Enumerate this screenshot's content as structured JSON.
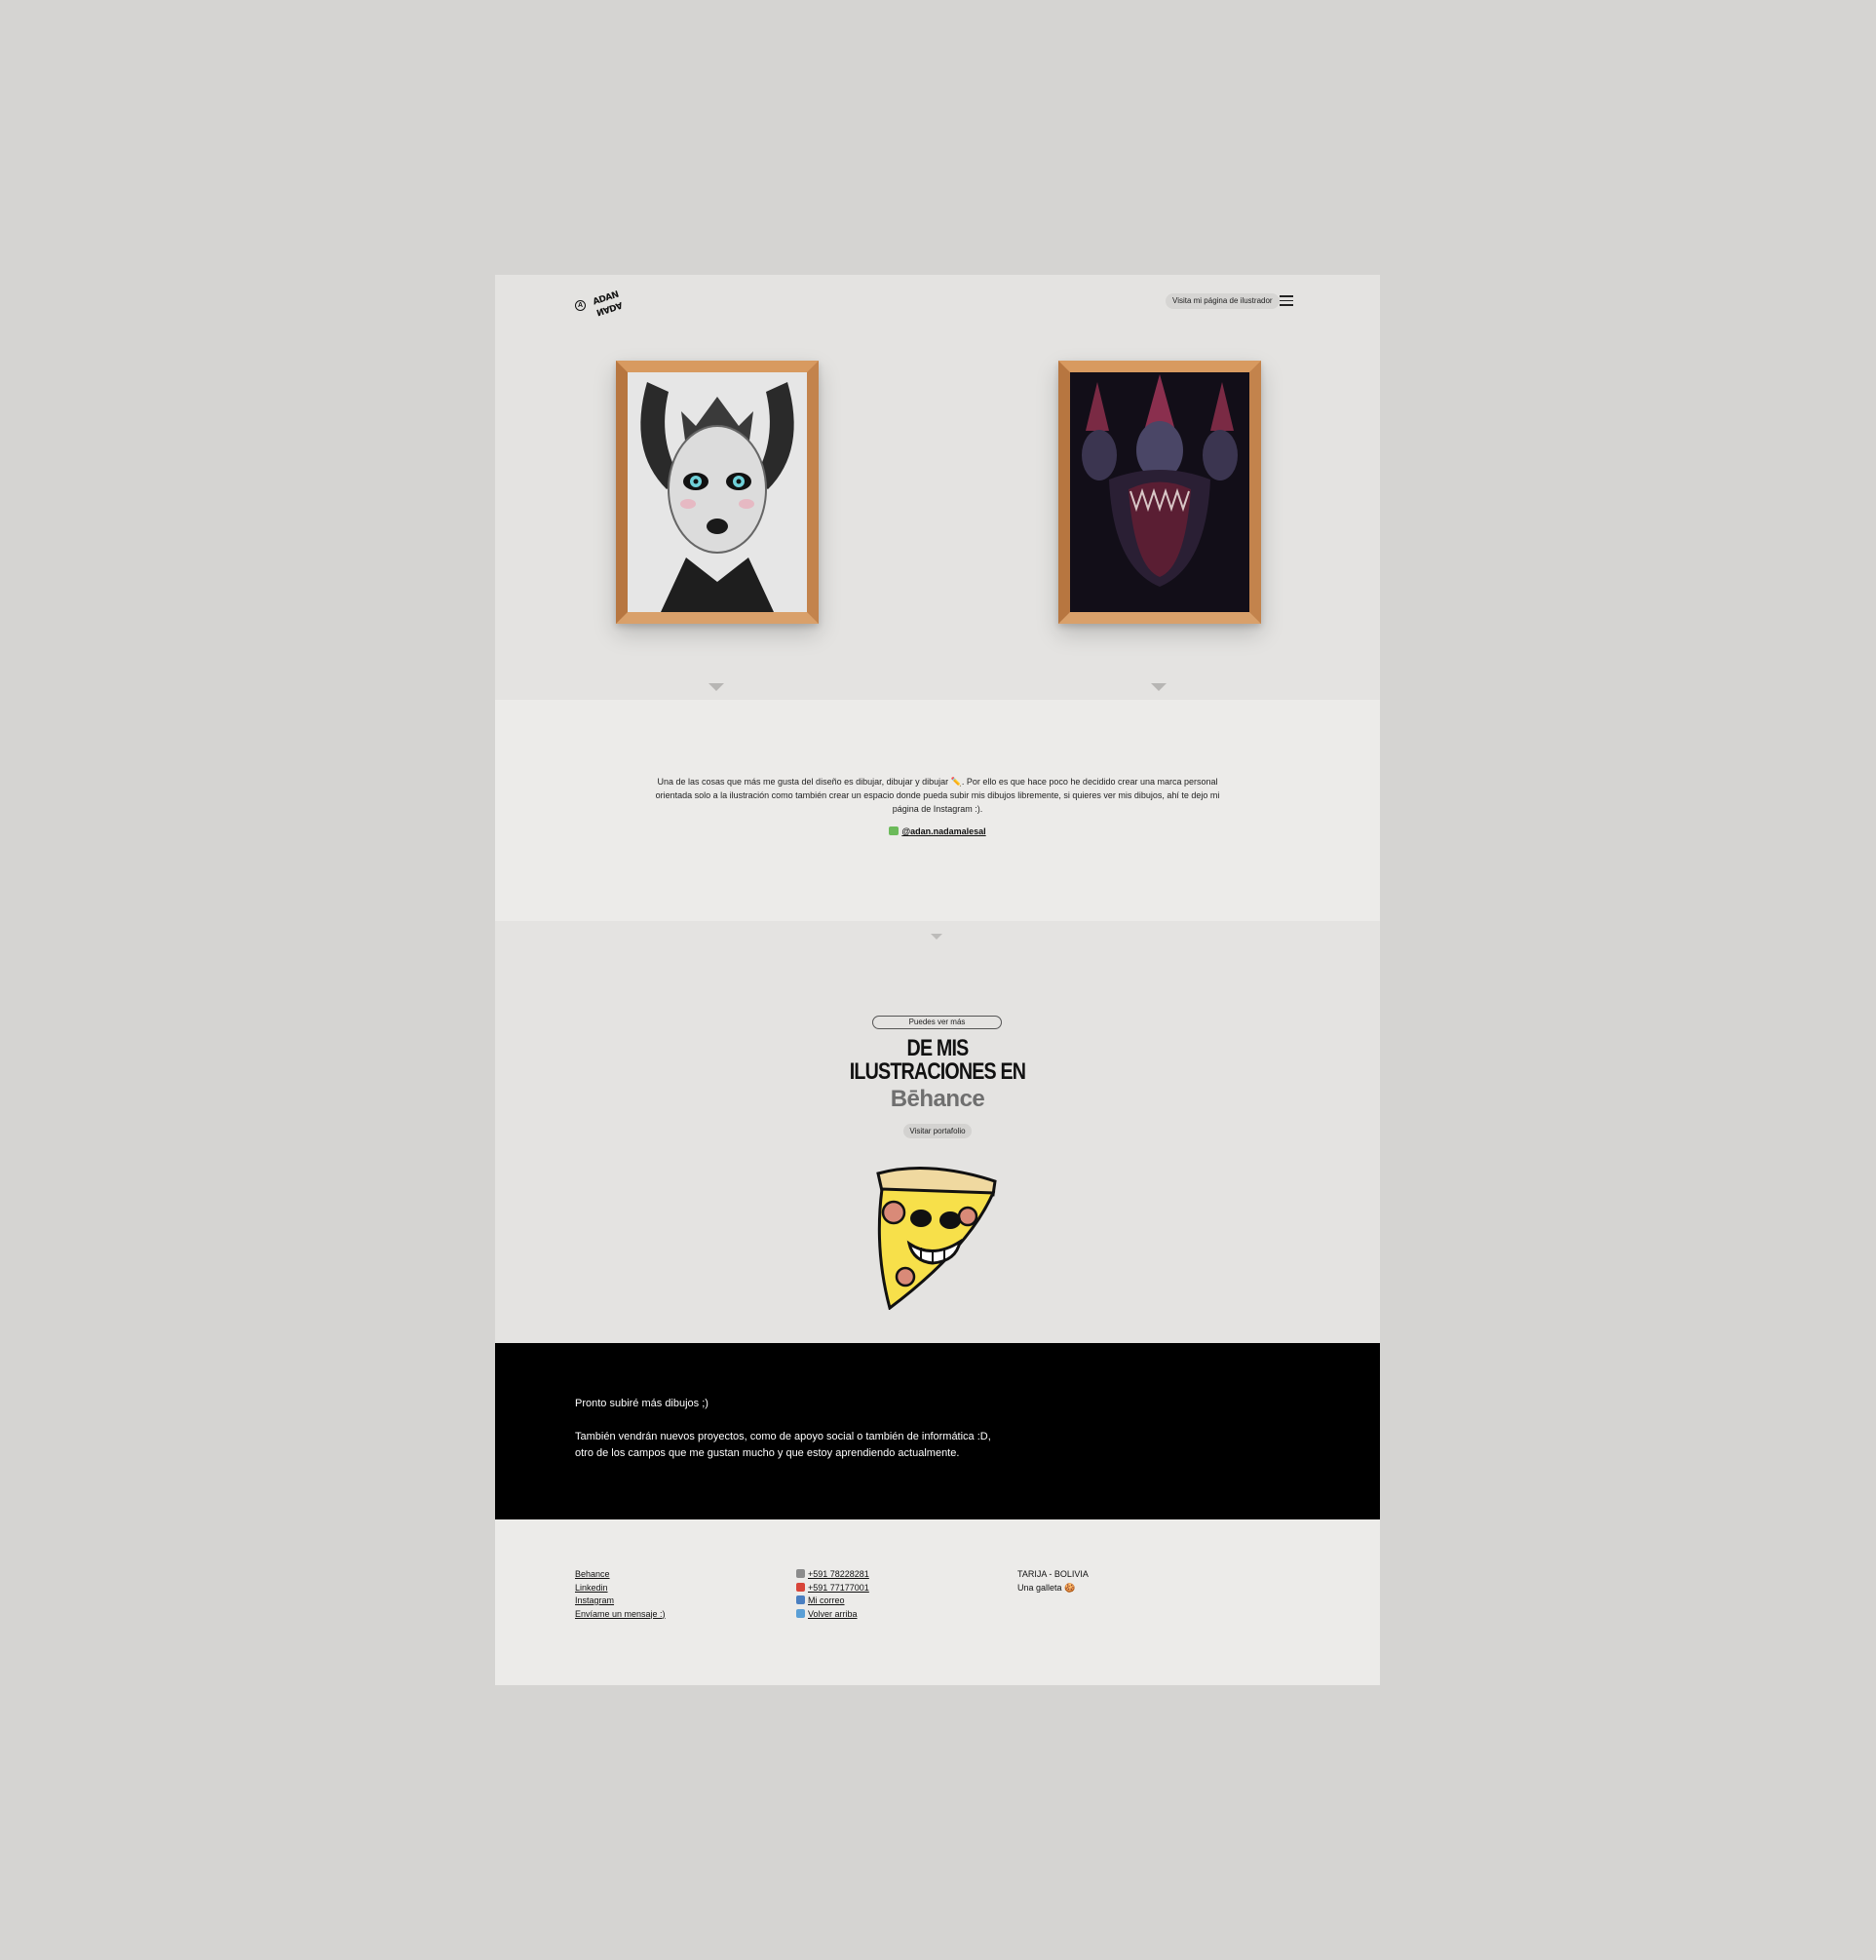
{
  "header": {
    "logo_mark": "A",
    "logo_top": "ADAN",
    "logo_bottom": "NADA",
    "nav_pill": "Visita mi página de ilustrador"
  },
  "gallery": {
    "frames": [
      "illustration-queen-portrait",
      "illustration-three-heads"
    ]
  },
  "intro": {
    "text": "Una de las cosas que más me gusta del diseño es dibujar, dibujar y dibujar ✏️. Por ello es que hace poco he decidido crear una marca personal orientada solo a la ilustración como también crear un espacio donde pueda subir mis dibujos libremente, si quieres ver mis dibujos, ahí te dejo mi página de Instagram :).",
    "instagram_link": "@adan.nadamalesal"
  },
  "behance": {
    "pill": "Puedes ver más",
    "title_line1": "DE MIS",
    "title_line2": "ILUSTRACIONES EN",
    "brand": "Bēhance",
    "button": "Visitar portafolio"
  },
  "dark": {
    "line1": "Pronto subiré más dibujos ;)",
    "line2": "También vendrán nuevos proyectos, como de apoyo social o también de informática :D,",
    "line3": "otro de los campos que me gustan mucho y que estoy aprendiendo actualmente."
  },
  "footer": {
    "links": [
      "Behance",
      "Linkedin",
      "Instagram",
      "Envíame un mensaje :)"
    ],
    "contact": [
      "+591 78228281",
      "+591 77177001",
      "Mi correo",
      "Volver arriba"
    ],
    "location": "TARIJA - BOLIVIA",
    "cookie": "Una galleta 🍪"
  },
  "colors": {
    "background": "#d5d4d2",
    "page": "#e4e3e1",
    "section_light": "#ecebe9",
    "dark": "#000000",
    "frame_wood": "#c98a52"
  }
}
